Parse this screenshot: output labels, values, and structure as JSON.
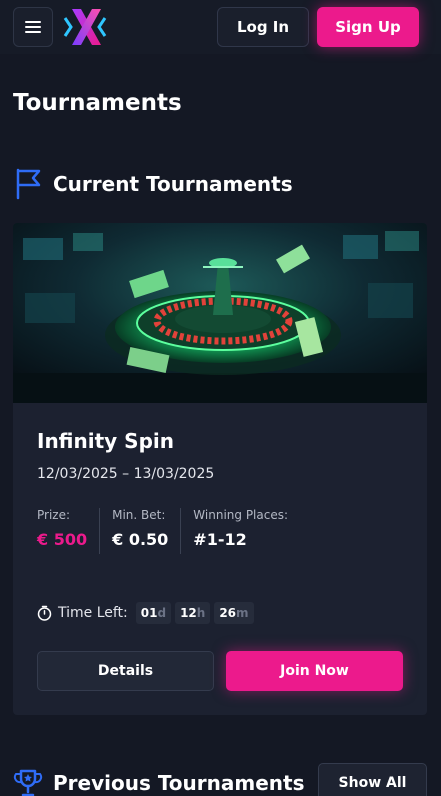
{
  "header": {
    "login_label": "Log In",
    "signup_label": "Sign Up",
    "icons": {
      "menu": "hamburger-menu-icon",
      "logo": "x-logo"
    }
  },
  "page": {
    "title": "Tournaments"
  },
  "current_section": {
    "title": "Current Tournaments",
    "icon": "flag-icon"
  },
  "tournament": {
    "banner": "roulette-wheel-with-banknotes",
    "name": "Infinity Spin",
    "dates": "12/03/2025 – 13/03/2025",
    "stats": [
      {
        "label": "Prize:",
        "value": "€ 500"
      },
      {
        "label": "Min. Bet:",
        "value": "€ 0.50"
      },
      {
        "label": "Winning Places:",
        "value": "#1-12"
      }
    ],
    "time_left_label": "Time Left:",
    "time_left": [
      {
        "value": "01",
        "unit": "d"
      },
      {
        "value": "12",
        "unit": "h"
      },
      {
        "value": "26",
        "unit": "m"
      }
    ],
    "details_label": "Details",
    "join_label": "Join Now"
  },
  "previous_section": {
    "title": "Previous Tournaments",
    "icon": "trophy-icon",
    "show_all_label": "Show All"
  },
  "colors": {
    "background": "#141824",
    "card": "#1c2130",
    "accent": "#ec1a8c",
    "icon_blue": "#2f6cf6"
  }
}
